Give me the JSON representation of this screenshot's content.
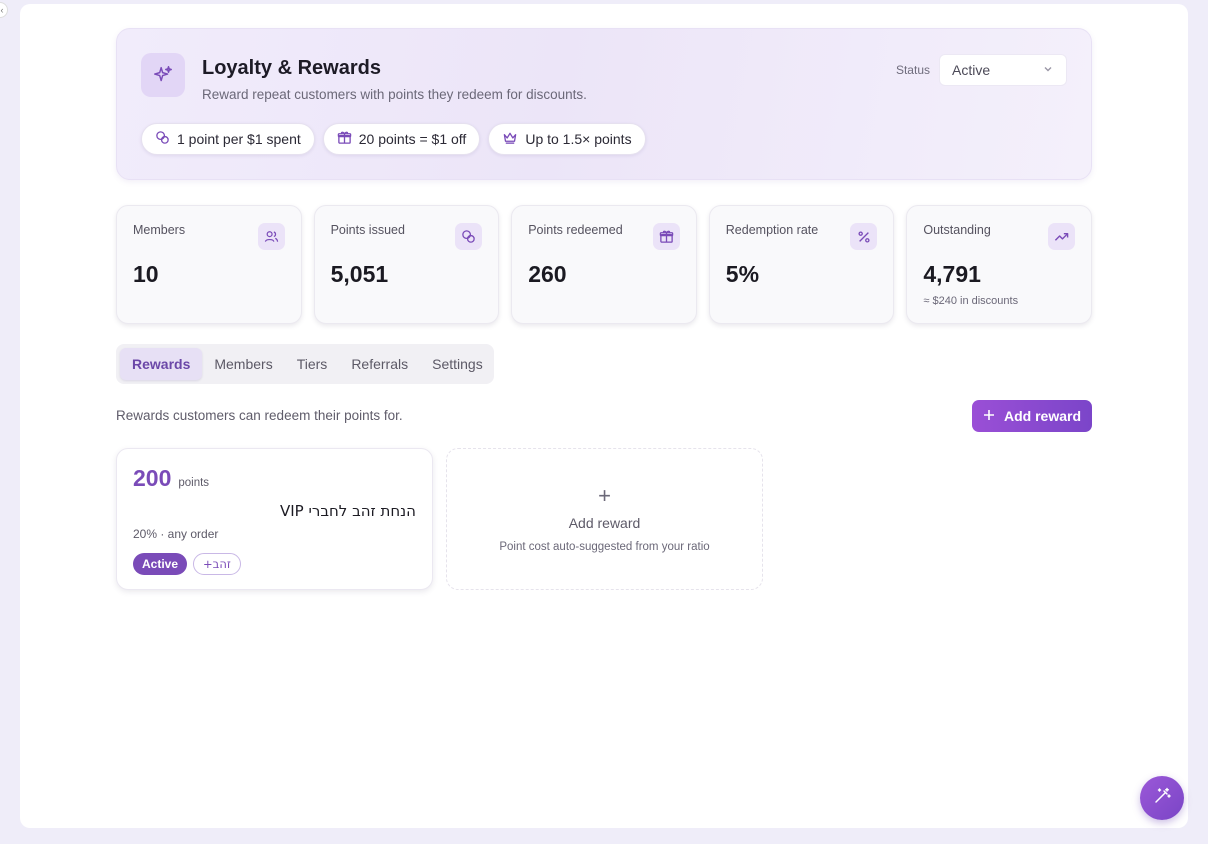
{
  "header": {
    "title": "Loyalty & Rewards",
    "subtitle": "Reward repeat customers with points they redeem for discounts.",
    "status_label": "Status",
    "status_value": "Active",
    "chips": [
      {
        "label": "1 point per $1 spent",
        "icon": "coins-icon"
      },
      {
        "label": "20 points = $1 off",
        "icon": "gift-icon"
      },
      {
        "label": "Up to 1.5× points",
        "icon": "crown-icon"
      }
    ]
  },
  "stats": [
    {
      "label": "Members",
      "value": "10",
      "note": "",
      "icon": "users-icon"
    },
    {
      "label": "Points issued",
      "value": "5,051",
      "note": "",
      "icon": "coins-icon"
    },
    {
      "label": "Points redeemed",
      "value": "260",
      "note": "",
      "icon": "gift-icon"
    },
    {
      "label": "Redemption rate",
      "value": "5%",
      "note": "",
      "icon": "percent-icon"
    },
    {
      "label": "Outstanding",
      "value": "4,791",
      "note": "≈ $240 in discounts",
      "icon": "trending-up-icon"
    }
  ],
  "tabs": [
    "Rewards",
    "Members",
    "Tiers",
    "Referrals",
    "Settings"
  ],
  "active_tab": "Rewards",
  "rewards_section": {
    "description": "Rewards customers can redeem their points for.",
    "add_button": "Add reward"
  },
  "reward_card": {
    "points": "200",
    "points_unit": "points",
    "name": "הנחת זהב לחברי VIP",
    "detail": "20% · any order",
    "status_badge": "Active",
    "tier_badge": "זהב+"
  },
  "add_card": {
    "plus": "+",
    "title": "Add reward",
    "subtitle": "Point cost auto-suggested from your ratio"
  },
  "colors": {
    "accent": "#7a4bb8",
    "button_gradient_start": "#9a4fd6",
    "button_gradient_end": "#7b45c9"
  }
}
